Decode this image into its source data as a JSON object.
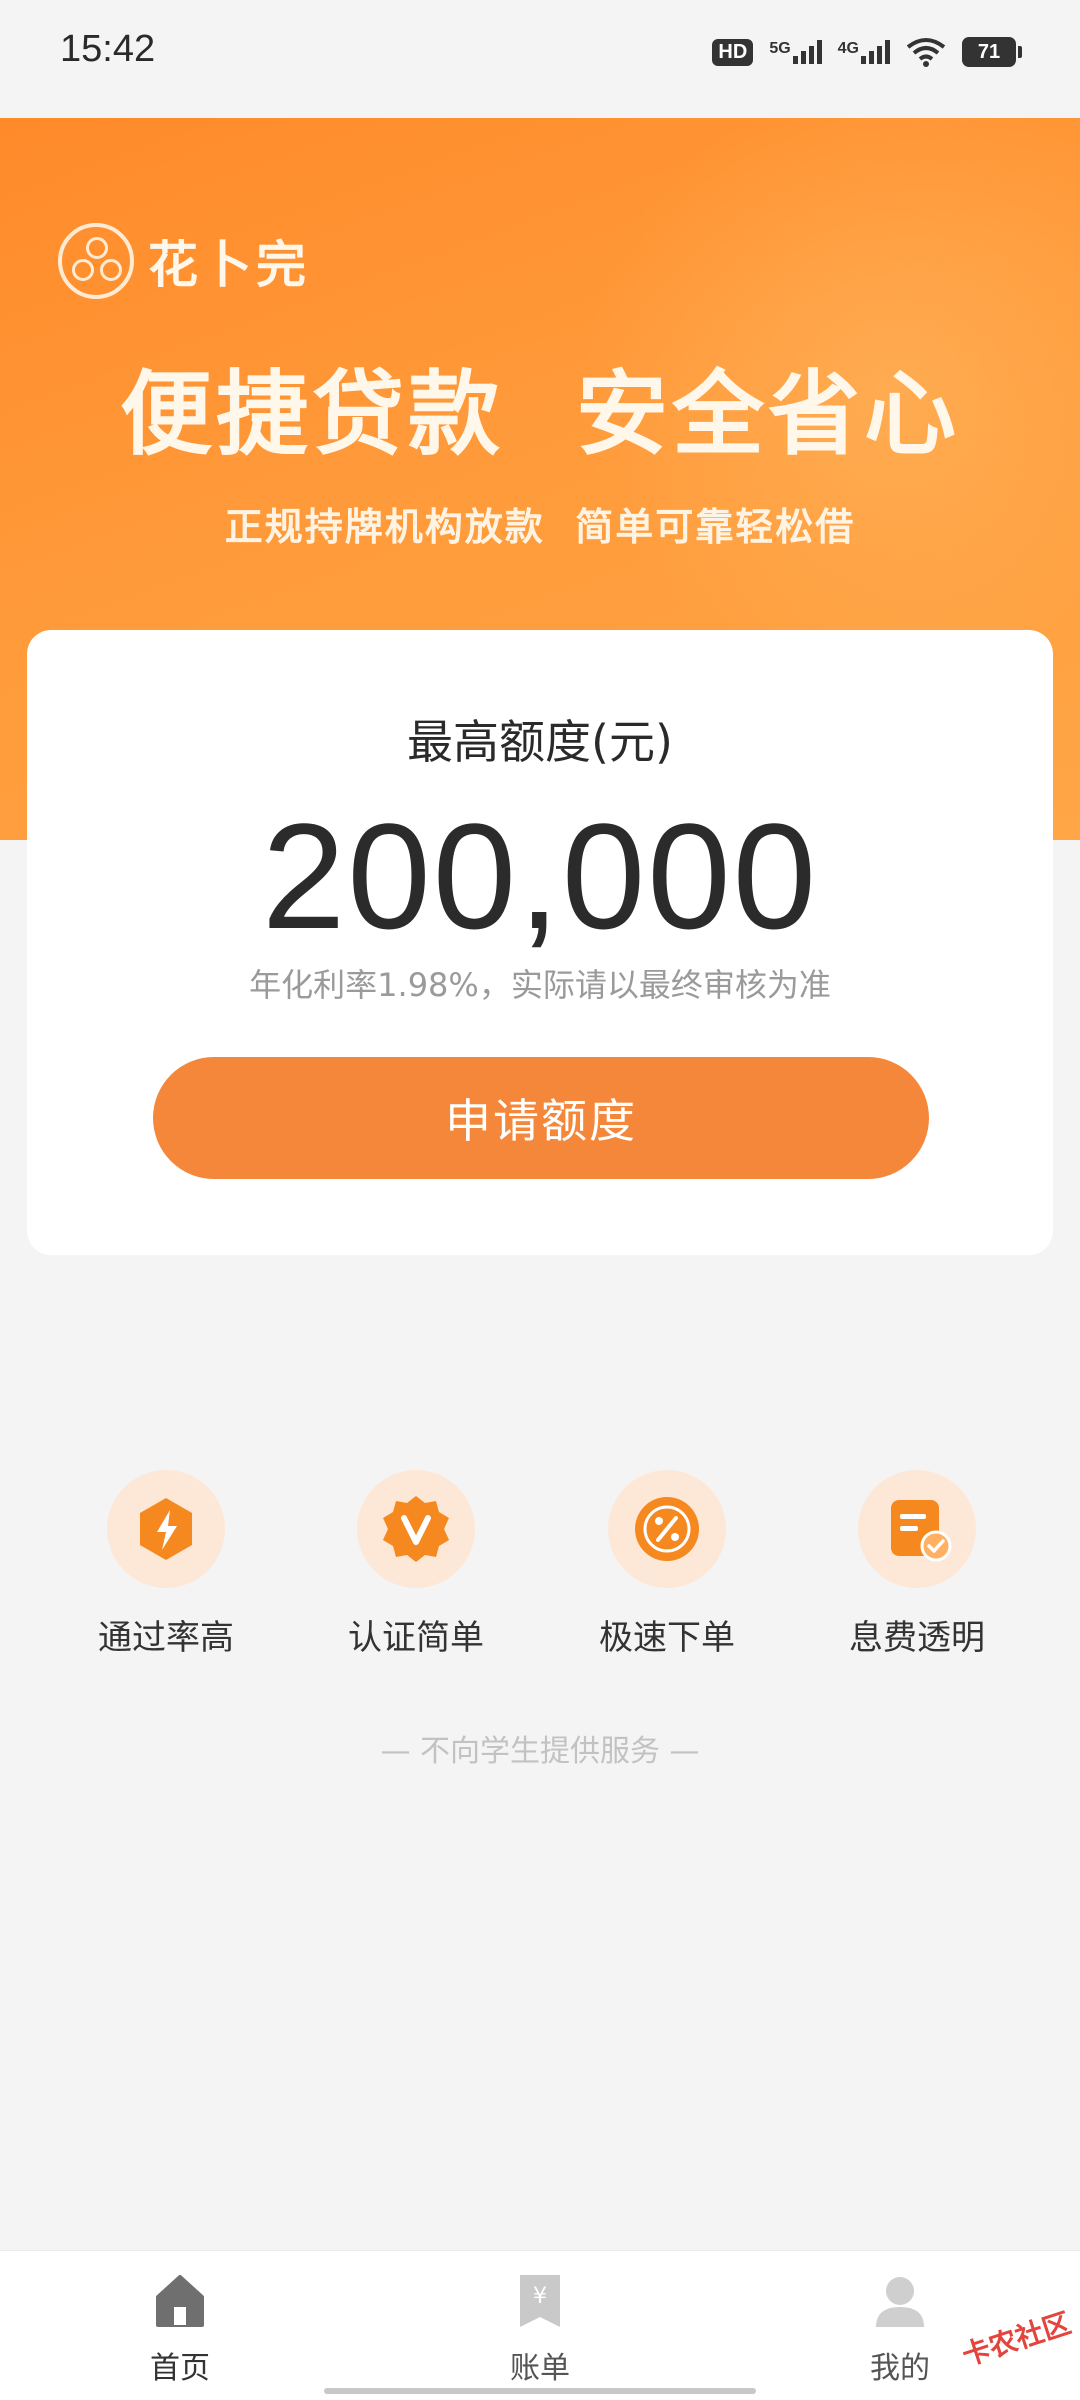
{
  "status_bar": {
    "time": "15:42",
    "hd_label": "HD",
    "network_1": "5G",
    "network_2": "4G",
    "battery": "71"
  },
  "banner": {
    "brand_name": "花卜完",
    "slogan": "便捷贷款  安全省心",
    "subslogan": "正规持牌机构放款  简单可靠轻松借"
  },
  "credit": {
    "label": "最高额度(元)",
    "amount": "200,000",
    "note": "年化利率1.98%，实际请以最终审核为准",
    "apply_label": "申请额度"
  },
  "features": [
    {
      "label": "通过率高",
      "icon": "lightning-icon"
    },
    {
      "label": "认证简单",
      "icon": "v-badge-icon"
    },
    {
      "label": "极速下单",
      "icon": "percent-icon"
    },
    {
      "label": "息费透明",
      "icon": "document-check-icon"
    }
  ],
  "student_note": "— 不向学生提供服务 —",
  "bottom_nav": [
    {
      "label": "首页",
      "icon": "home-icon",
      "active": true
    },
    {
      "label": "账单",
      "icon": "bill-icon",
      "active": false
    },
    {
      "label": "我的",
      "icon": "user-icon",
      "active": false
    }
  ],
  "watermark": "卡农社区",
  "colors": {
    "accent": "#f5873a",
    "banner": "#ff9a3a",
    "icon_bg": "#fde8d8",
    "icon_orange": "#f5881f"
  }
}
